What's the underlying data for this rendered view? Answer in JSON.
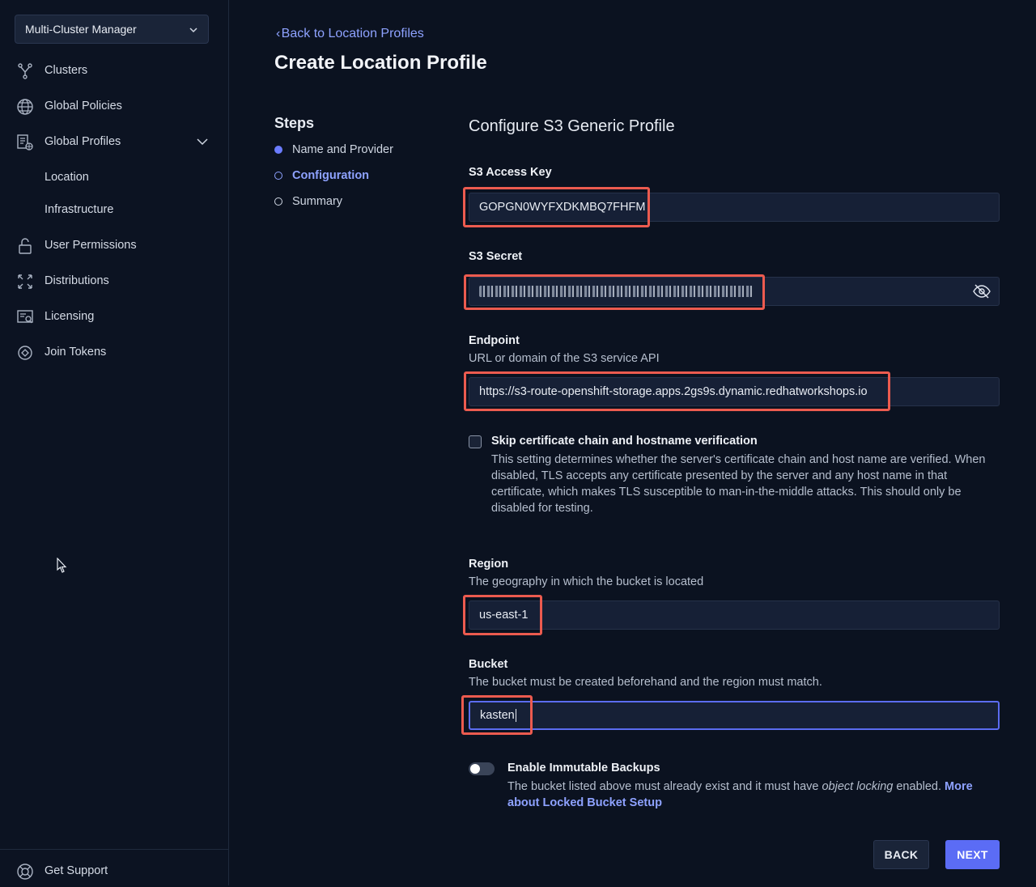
{
  "sidebar": {
    "cluster_selector": "Multi-Cluster Manager",
    "items": [
      {
        "label": "Clusters",
        "icon": "clusters-icon"
      },
      {
        "label": "Global Policies",
        "icon": "globe-icon"
      },
      {
        "label": "Global Profiles",
        "icon": "profiles-icon"
      },
      {
        "label": "User Permissions",
        "icon": "lock-icon"
      },
      {
        "label": "Distributions",
        "icon": "distribution-icon"
      },
      {
        "label": "Licensing",
        "icon": "license-icon"
      },
      {
        "label": "Join Tokens",
        "icon": "token-icon"
      }
    ],
    "subitems": [
      "Location",
      "Infrastructure"
    ],
    "footer": {
      "label": "Get Support",
      "icon": "lifebuoy-icon"
    }
  },
  "header": {
    "back_link": "Back to Location Profiles",
    "title": "Create Location Profile"
  },
  "steps": {
    "title": "Steps",
    "items": [
      "Name and Provider",
      "Configuration",
      "Summary"
    ]
  },
  "form": {
    "title": "Configure S3 Generic Profile",
    "access_key": {
      "label": "S3 Access Key",
      "value": "GOPGN0WYFXDKMBQ7FHFM"
    },
    "secret": {
      "label": "S3 Secret"
    },
    "endpoint": {
      "label": "Endpoint",
      "help": "URL or domain of the S3 service API",
      "value": "https://s3-route-openshift-storage.apps.2gs9s.dynamic.redhatworkshops.io"
    },
    "skip_verify": {
      "label": "Skip certificate chain and hostname verification",
      "description": "This setting determines whether the server's certificate chain and host name are verified. When disabled, TLS accepts any certificate presented by the server and any host name in that certificate, which makes TLS susceptible to man-in-the-middle attacks. This should only be disabled for testing."
    },
    "region": {
      "label": "Region",
      "help": "The geography in which the bucket is located",
      "value": "us-east-1"
    },
    "bucket": {
      "label": "Bucket",
      "help": "The bucket must be created beforehand and the region must match.",
      "value": "kasten"
    },
    "immutable": {
      "label": "Enable Immutable Backups",
      "desc_before": "The bucket listed above must already exist and it must have ",
      "desc_em": "object locking",
      "desc_after": " enabled. ",
      "more_link": "More about Locked Bucket Setup"
    }
  },
  "buttons": {
    "back": "BACK",
    "next": "NEXT"
  },
  "colors": {
    "accent": "#5b6cf5",
    "link": "#8ea2ff",
    "highlight": "#ec5b4f",
    "background": "#0b1220"
  }
}
